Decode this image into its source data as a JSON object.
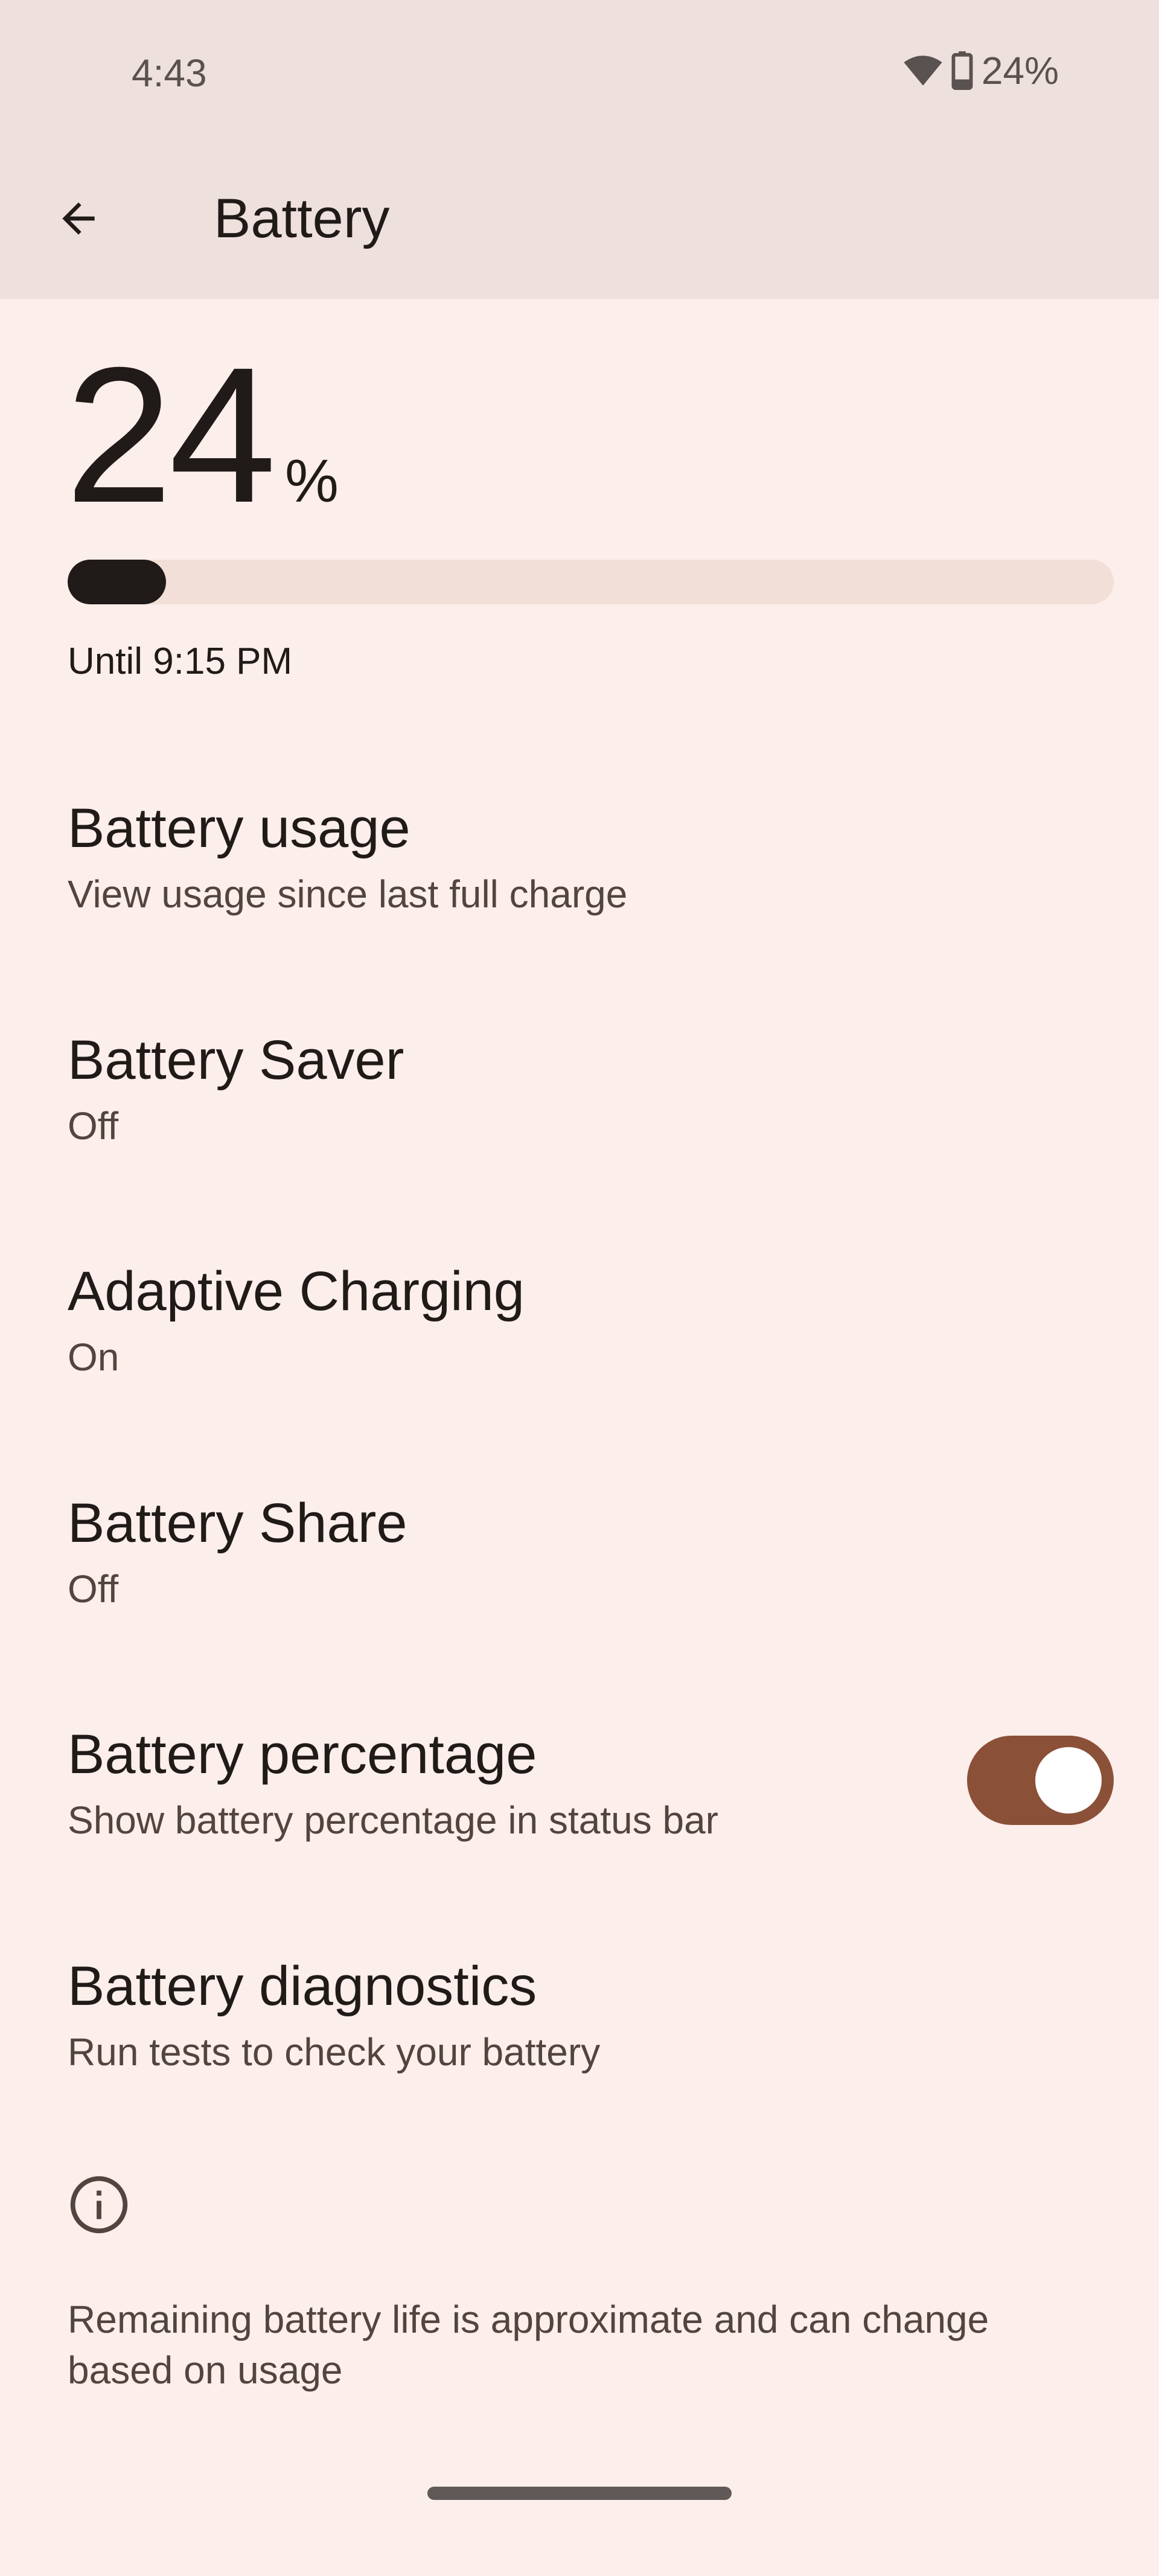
{
  "status_bar": {
    "time": "4:43",
    "battery_text": "24%",
    "icons": [
      "wifi-icon",
      "battery-icon"
    ]
  },
  "header": {
    "back_icon": "arrow-left-icon",
    "title": "Battery"
  },
  "battery": {
    "level_percent": 24,
    "level_number": "24",
    "percent_sign": "%",
    "until": "Until 9:15 PM"
  },
  "items": [
    {
      "title": "Battery usage",
      "subtitle": "View usage since last full charge"
    },
    {
      "title": "Battery Saver",
      "subtitle": "Off"
    },
    {
      "title": "Adaptive Charging",
      "subtitle": "On"
    },
    {
      "title": "Battery Share",
      "subtitle": "Off"
    },
    {
      "title": "Battery percentage",
      "subtitle": "Show battery percentage in status bar",
      "toggle": true
    },
    {
      "title": "Battery diagnostics",
      "subtitle": "Run tests to check your battery"
    }
  ],
  "footer": {
    "icon": "info-icon",
    "text": "Remaining battery life is approximate and can change based on usage"
  },
  "colors": {
    "background": "#FCEEEA",
    "header": "#EEE0DC",
    "accent": "#8B5038",
    "bar_track": "#F1DFD8",
    "bar_fill": "#201A18"
  }
}
